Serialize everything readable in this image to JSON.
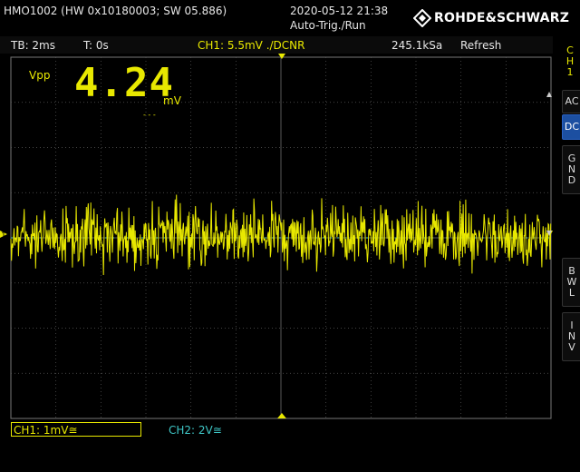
{
  "header": {
    "device_info": "HMO1002 (HW 0x10180003; SW 05.886)",
    "datetime": "2020-05-12 21:38",
    "trigger_mode": "Auto-Trig./Run",
    "brand": "ROHDE&SCHWARZ"
  },
  "status": {
    "timebase": "TB: 2ms",
    "trigger_time": "T: 0s",
    "ch1_trigger": "CH1: 5.5mV ./DCNR",
    "sample_rate": "245.1kSa",
    "acq_mode": "Refresh"
  },
  "measurement": {
    "label": "Vpp",
    "value": "4.24",
    "unit": "mV",
    "sub": "- - -"
  },
  "channels": [
    {
      "label": "CH1: 1mV≅",
      "color": "#e8e800"
    },
    {
      "label": "CH2: 2V≅",
      "color": "#3fc7c7"
    }
  ],
  "side_menu": {
    "ch_label": [
      "C",
      "H",
      "1"
    ],
    "buttons": [
      {
        "id": "ac",
        "lines": [
          "AC"
        ],
        "active": false
      },
      {
        "id": "dc",
        "lines": [
          "DC"
        ],
        "active": true
      },
      {
        "id": "gnd",
        "lines": [
          "G",
          "N",
          "D"
        ],
        "active": false
      },
      {
        "id": "bwl",
        "lines": [
          "B",
          "W",
          "L"
        ],
        "active": false
      },
      {
        "id": "inv",
        "lines": [
          "I",
          "N",
          "V"
        ],
        "active": false
      }
    ]
  },
  "markers": {
    "ch1_ground": "1"
  },
  "colors": {
    "trace": "#e8e800",
    "grid": "#595959",
    "accent": "#1c4fa1",
    "ch2": "#3fc7c7"
  }
}
